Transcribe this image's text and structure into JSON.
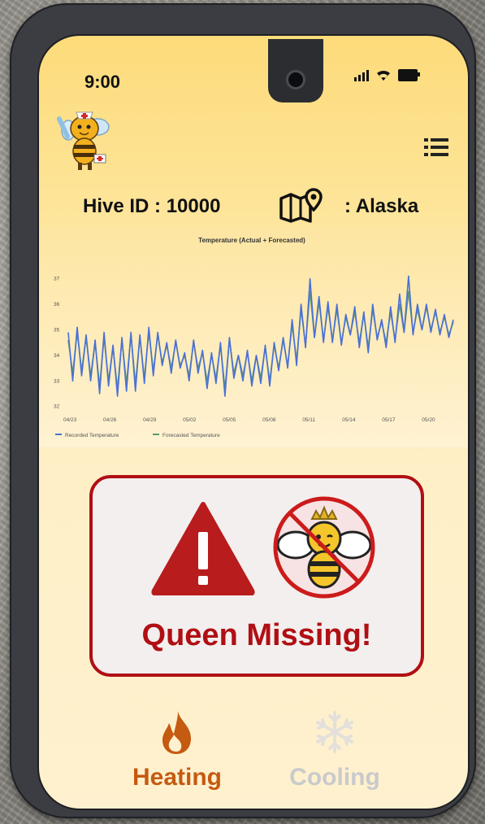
{
  "status_bar": {
    "time": "9:00"
  },
  "hive": {
    "id_label": "Hive ID : 10000",
    "location_label": ": Alaska"
  },
  "chart_data": {
    "type": "line",
    "title": "Temperature (Actual + Forecasted)",
    "xlabel": "",
    "ylabel": "",
    "x_ticks": [
      "04/23",
      "04/26",
      "04/29",
      "05/02",
      "05/05",
      "05/08",
      "05/11",
      "05/14",
      "05/17",
      "05/20"
    ],
    "y_ticks": [
      32,
      33,
      34,
      35,
      36,
      37
    ],
    "ylim": [
      31.8,
      37.4
    ],
    "x_range_days": [
      0,
      29
    ],
    "grid": false,
    "legend_position": "bottom-left",
    "series": [
      {
        "name": "Recorded Temperature",
        "color": "#4a6fd6",
        "values": [
          34.9,
          33.0,
          35.1,
          33.2,
          34.8,
          33.0,
          34.6,
          32.5,
          34.9,
          32.8,
          34.4,
          32.4,
          34.7,
          32.6,
          34.9,
          32.6,
          34.8,
          32.9,
          35.1,
          33.2,
          34.9,
          33.6,
          34.5,
          33.3,
          34.6,
          33.5,
          34.1,
          33.0,
          34.6,
          33.3,
          34.2,
          32.7,
          34.1,
          32.9,
          34.5,
          32.4,
          34.7,
          33.1,
          34.0,
          33.0,
          34.2,
          32.8,
          34.0,
          32.9,
          34.4,
          32.8,
          34.5,
          33.4,
          34.7,
          33.5,
          35.4,
          33.6,
          36.0,
          34.3,
          37.0,
          34.7,
          36.3,
          34.5,
          36.1,
          34.5,
          36.0,
          34.4,
          35.6,
          34.8,
          35.9,
          34.3,
          35.7,
          34.1,
          36.0,
          34.6,
          35.4,
          34.3,
          35.9,
          34.5,
          36.4,
          34.9,
          37.1,
          34.8,
          36.0,
          35.0,
          36.0,
          34.9,
          35.8,
          34.8,
          35.6,
          34.7,
          35.4
        ]
      },
      {
        "name": "Forecasted Temperature",
        "color": "#5e9a6e",
        "values": [
          34.6,
          33.3,
          34.9,
          33.4,
          34.7,
          33.2,
          34.5,
          32.8,
          34.7,
          33.0,
          34.3,
          32.7,
          34.6,
          32.9,
          34.8,
          32.9,
          34.7,
          33.1,
          34.9,
          33.4,
          34.8,
          33.7,
          34.4,
          33.5,
          34.5,
          33.6,
          34.0,
          33.2,
          34.5,
          33.5,
          34.1,
          33.0,
          34.0,
          33.1,
          34.4,
          32.7,
          34.6,
          33.3,
          34.0,
          33.2,
          34.1,
          33.0,
          34.0,
          33.1,
          34.3,
          33.0,
          34.4,
          33.5,
          34.6,
          33.6,
          35.2,
          33.8,
          35.8,
          34.4,
          36.5,
          34.7,
          36.1,
          34.6,
          35.9,
          34.6,
          35.8,
          34.5,
          35.5,
          34.8,
          35.7,
          34.5,
          35.6,
          34.3,
          35.8,
          34.7,
          35.3,
          34.5,
          35.7,
          34.6,
          36.0,
          34.9,
          36.5,
          34.9,
          35.8,
          35.0,
          35.9,
          35.0,
          35.7,
          34.9,
          35.5,
          34.8,
          35.3
        ]
      }
    ]
  },
  "alert": {
    "text": "Queen Missing!",
    "color": "#b00f14"
  },
  "nav": {
    "heating_label": "Heating",
    "cooling_label": "Cooling"
  },
  "icons": {
    "logo": "bee-nurse-logo-icon",
    "menu": "menu-list-icon",
    "map": "map-pin-icon",
    "warning": "warning-triangle-icon",
    "queen": "no-queen-bee-icon",
    "heating": "flame-icon",
    "cooling": "snowflake-icon"
  }
}
